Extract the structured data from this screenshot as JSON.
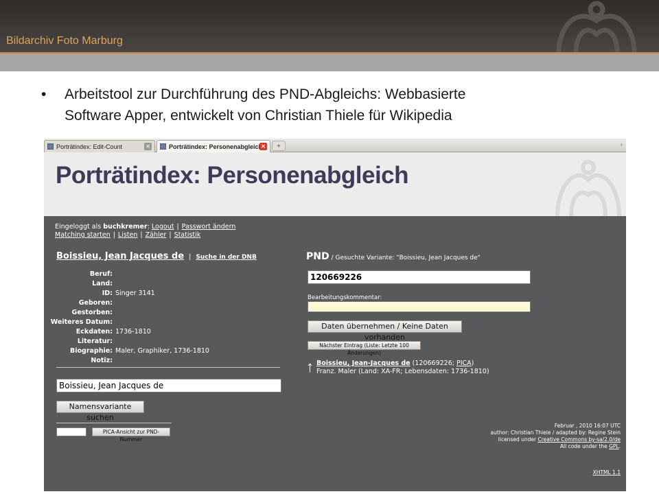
{
  "slide": {
    "title": "Bildarchiv Foto Marburg",
    "bullet_marker": "•",
    "bullet_line1": "Arbeitstool zur Durchführung des PND-Abgleichs: Webbasierte",
    "bullet_line2": "Software Apper, entwickelt von Christian Thiele für Wikipedia",
    "accent_color": "#c8893e"
  },
  "browser": {
    "tabs": [
      {
        "label": "Porträtindex: Edit-Count",
        "active": false
      },
      {
        "label": "Porträtindex: Personenabgleich",
        "active": true
      }
    ],
    "new_tab_label": "+"
  },
  "app": {
    "title": "Porträtindex: Personenabgleich",
    "login": {
      "prefix": "Eingeloggt als",
      "user": "buchkremer",
      "logout": "Logout",
      "change_password": "Passwort ändern"
    },
    "nav": [
      "Matching starten",
      "Listen",
      "Zähler",
      "Statistik"
    ],
    "left": {
      "name": "Boissieu, Jean Jacques de",
      "dnb_link": "Suche in der DNB",
      "fields": [
        {
          "label": "Beruf:",
          "value": ""
        },
        {
          "label": "Land:",
          "value": ""
        },
        {
          "label": "ID:",
          "value": "Singer 3141"
        },
        {
          "label": "Geboren:",
          "value": ""
        },
        {
          "label": "Gestorben:",
          "value": ""
        },
        {
          "label": "Weiteres Datum:",
          "value": ""
        },
        {
          "label": "Eckdaten:",
          "value": "1736-1810"
        },
        {
          "label": "Literatur:",
          "value": ""
        },
        {
          "label": "Biographie:",
          "value": "Maler, Graphiker, 1736-1810"
        },
        {
          "label": "Notiz:",
          "value": ""
        }
      ],
      "name_input_value": "Boissieu, Jean Jacques de",
      "search_variant_button": "Namensvariante suchen",
      "pica_input_value": "",
      "pica_button": "PICA-Ansicht zur PND-Nummer"
    },
    "right": {
      "pnd_label": "PND",
      "variant_text": "/ Gesuchte Variante: \"Boissieu, Jean Jacques de\"",
      "pnd_input_value": "120669226",
      "comment_label": "Bearbeitungskommentar:",
      "comment_value": "",
      "submit_button": "Daten übernehmen / Keine Daten vorhanden",
      "next_button": "Nächster Eintrag (Liste: Letzte 100 Änderungen)",
      "result": {
        "arrow": "↑",
        "name": "Boissieu, Jean-Jacques de",
        "id_prefix": "(120669226;",
        "pica_link": "PICA",
        "id_suffix": ")",
        "details": "Franz. Maler (Land: XA-FR; Lebensdaten: 1736-1810)"
      }
    },
    "footer": {
      "date": "Februar , 2010 16:07 UTC",
      "author": "author: Christian Thiele / adapted by: Regine Stein",
      "license_prefix": "licensed under",
      "license_link": "Creative Commons by-sa/2.0/de",
      "code_prefix": "All code under the",
      "code_link": "GPL",
      "code_suffix": ".",
      "xhtml": "XHTML 1.1"
    }
  }
}
